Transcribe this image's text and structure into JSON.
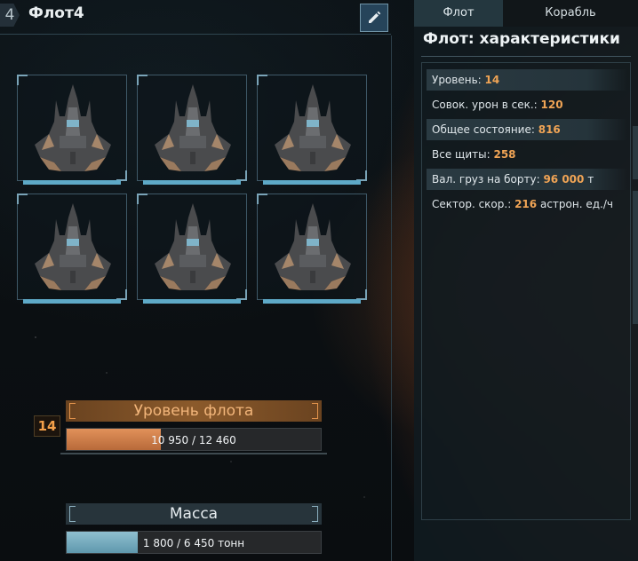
{
  "header": {
    "fleet_number": "4",
    "title": "Флот4",
    "edit_icon": "pencil-icon"
  },
  "ships": [
    {
      "icon": "ship-icon"
    },
    {
      "icon": "ship-icon"
    },
    {
      "icon": "ship-icon"
    },
    {
      "icon": "ship-icon"
    },
    {
      "icon": "ship-icon"
    },
    {
      "icon": "ship-icon"
    }
  ],
  "level": {
    "badge": "14",
    "title": "Уровень флота",
    "progress_text": "10 950 / 12 460",
    "progress_fraction": 0.3715
  },
  "mass": {
    "title": "Масса",
    "progress_text": "1 800 / 6 450 тонн",
    "progress_fraction": 0.279
  },
  "tabs": [
    {
      "label": "Флот"
    },
    {
      "label": "Корабль"
    }
  ],
  "panel": {
    "title": "Флот: характеристики",
    "stats": [
      {
        "label": "Уровень:",
        "value": "14",
        "unit": ""
      },
      {
        "label": "Совок. урон в сек.:",
        "value": "120",
        "unit": ""
      },
      {
        "label": "Общее состояние:",
        "value": "816",
        "unit": ""
      },
      {
        "label": "Все щиты:",
        "value": "258",
        "unit": ""
      },
      {
        "label": "Вал. груз на борту:",
        "value": "96 000",
        "unit": "т"
      },
      {
        "label": "Сектор. скор.:",
        "value": "216",
        "unit": "астрон. ед./ч"
      }
    ]
  },
  "colors": {
    "accent_orange": "#f0a455",
    "accent_blue": "#5ea9c7"
  }
}
